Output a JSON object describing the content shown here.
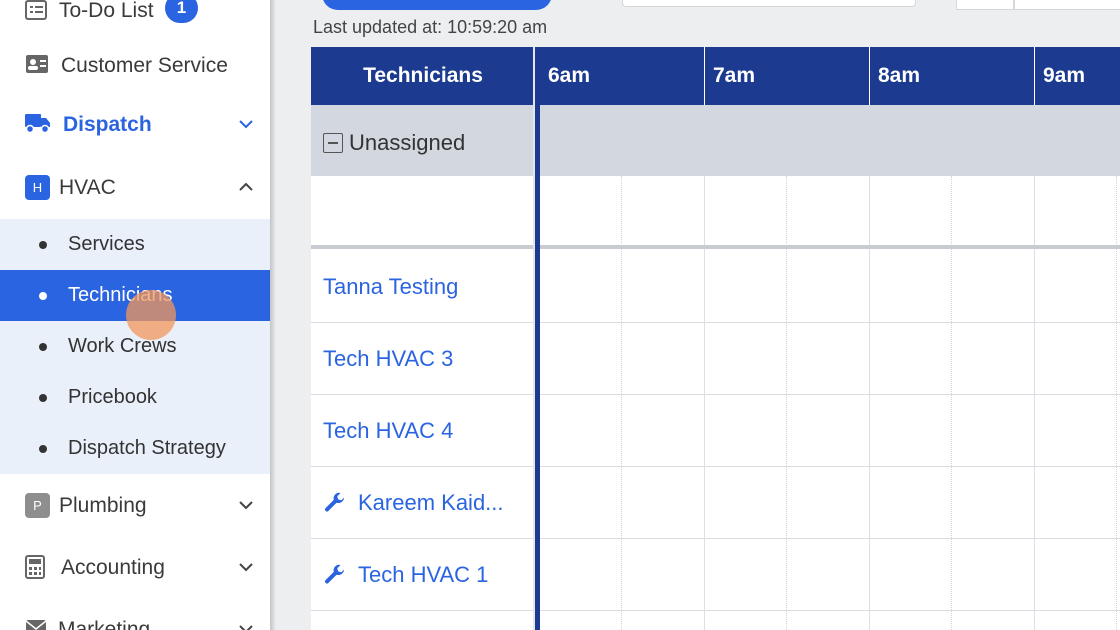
{
  "sidebar": {
    "todo": {
      "label": "To-Do List",
      "badge": "1"
    },
    "customer_service": {
      "label": "Customer Service"
    },
    "dispatch": {
      "label": "Dispatch"
    },
    "hvac": {
      "label": "HVAC",
      "letter": "H",
      "items": [
        {
          "label": "Services"
        },
        {
          "label": "Technicians"
        },
        {
          "label": "Work Crews"
        },
        {
          "label": "Pricebook"
        },
        {
          "label": "Dispatch Strategy"
        }
      ]
    },
    "plumbing": {
      "label": "Plumbing",
      "letter": "P"
    },
    "accounting": {
      "label": "Accounting"
    },
    "marketing": {
      "label": "Marketing"
    }
  },
  "header": {
    "last_updated": "Last updated at: 10:59:20 am"
  },
  "schedule": {
    "tech_header": "Technicians",
    "hours": [
      "6am",
      "7am",
      "8am",
      "9am"
    ],
    "unassigned_label": "Unassigned",
    "technicians": [
      {
        "name": "Tanna Testing",
        "icon": ""
      },
      {
        "name": "Tech HVAC 3",
        "icon": ""
      },
      {
        "name": "Tech HVAC 4",
        "icon": ""
      },
      {
        "name": "Kareem Kaid...",
        "icon": "wrench-icon"
      },
      {
        "name": "Tech HVAC 1",
        "icon": "wrench-icon"
      }
    ]
  },
  "colors": {
    "accent": "#2b64e0",
    "header_bg": "#1c3a8f",
    "submenu_bg": "#e9f0fa",
    "unassigned_bg": "#d3d7e0"
  }
}
